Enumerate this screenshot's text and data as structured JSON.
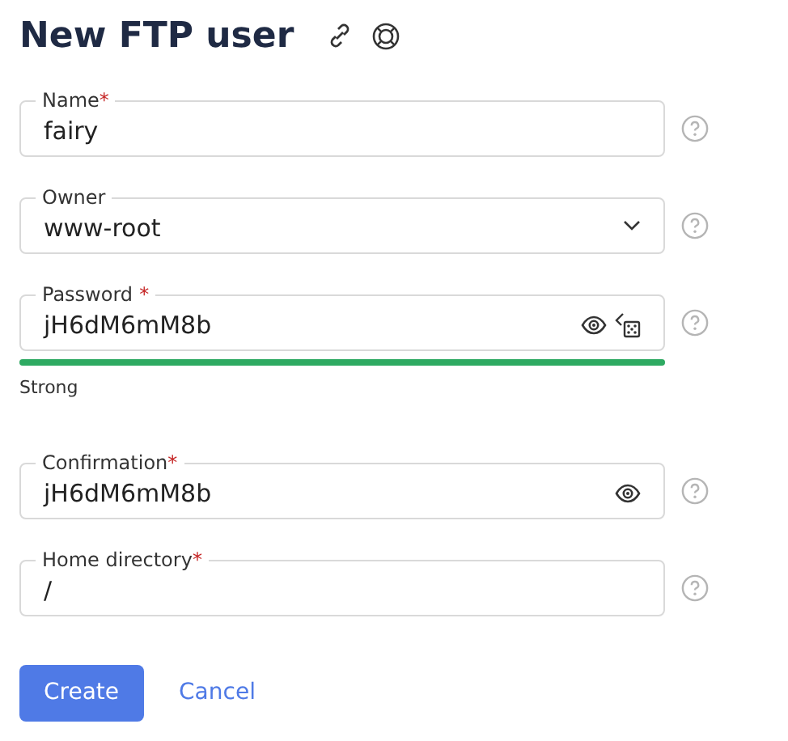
{
  "title": "New FTP user",
  "fields": [
    {
      "kind": "text",
      "label": "Name",
      "mark": "*",
      "mark_gap": false,
      "value": "fairy"
    },
    {
      "kind": "select",
      "label": "Owner",
      "value": "www-root"
    },
    {
      "kind": "password",
      "label": "Password",
      "mark": "*",
      "mark_gap": true,
      "value": "jH6dM6mM8b",
      "generate": true,
      "strength": {
        "level": 1,
        "label": "Strong"
      }
    },
    {
      "kind": "password",
      "label": "Confirmation",
      "mark": "*",
      "mark_gap": false,
      "value": "jH6dM6mM8b",
      "generate": false
    },
    {
      "kind": "text",
      "label": "Home directory",
      "mark": "*",
      "mark_gap": false,
      "value": "/"
    }
  ],
  "buttons": [
    {
      "kind": "primary",
      "label": "Create"
    },
    {
      "kind": "link",
      "label": "Cancel"
    }
  ]
}
